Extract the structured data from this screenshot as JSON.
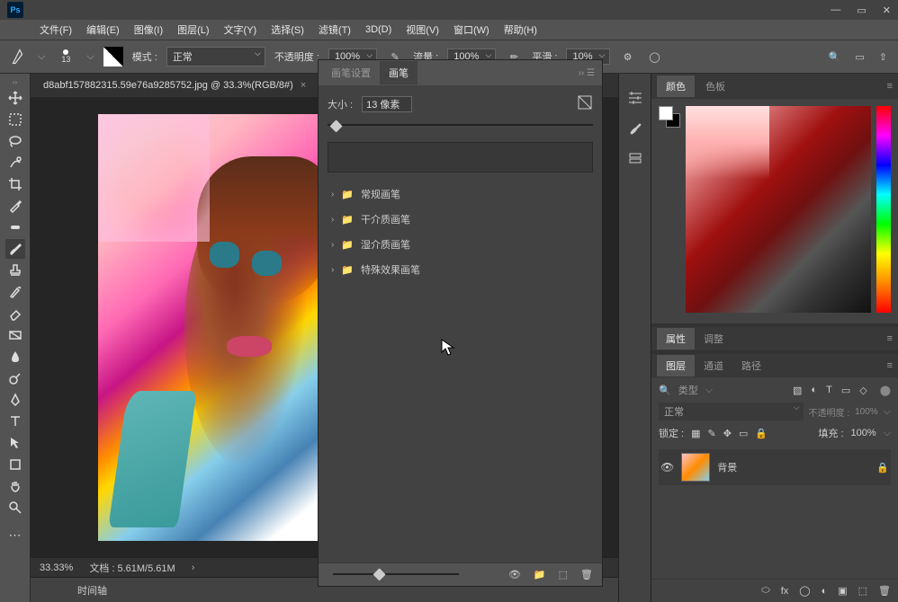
{
  "menu": {
    "file": "文件(F)",
    "edit": "编辑(E)",
    "image": "图像(I)",
    "layer": "图层(L)",
    "text": "文字(Y)",
    "select": "选择(S)",
    "filter": "滤镜(T)",
    "threed": "3D(D)",
    "view": "视图(V)",
    "window": "窗口(W)",
    "help": "帮助(H)"
  },
  "toolbar": {
    "size": "13",
    "mode_label": "模式 :",
    "mode_value": "正常",
    "opacity_label": "不透明度 :",
    "opacity_value": "100%",
    "flow_label": "流量 :",
    "flow_value": "100%",
    "smooth_label": "平滑 :",
    "smooth_value": "10%"
  },
  "document": {
    "title": "d8abf157882315.59e76a9285752.jpg @ 33.3%(RGB/8#)",
    "zoom": "33.33%",
    "doc_info": "文档 : 5.61M/5.61M"
  },
  "brush_panel": {
    "tab_settings": "画笔设置",
    "tab_brush": "画笔",
    "size_label": "大小 :",
    "size_value": "13 像素",
    "folders": [
      "常规画笔",
      "干介质画笔",
      "湿介质画笔",
      "特殊效果画笔"
    ]
  },
  "right": {
    "color": "颜色",
    "swatches": "色板",
    "properties": "属性",
    "adjust": "调整",
    "layers": "图层",
    "channels": "通道",
    "paths": "路径",
    "type": "类型",
    "blend": "正常",
    "opacity_lbl": "不透明度 :",
    "opacity_val": "100%",
    "lock": "锁定 :",
    "fill_lbl": "填充 :",
    "fill_val": "100%",
    "bg_layer": "背景"
  },
  "timeline": {
    "label": "时间轴"
  }
}
